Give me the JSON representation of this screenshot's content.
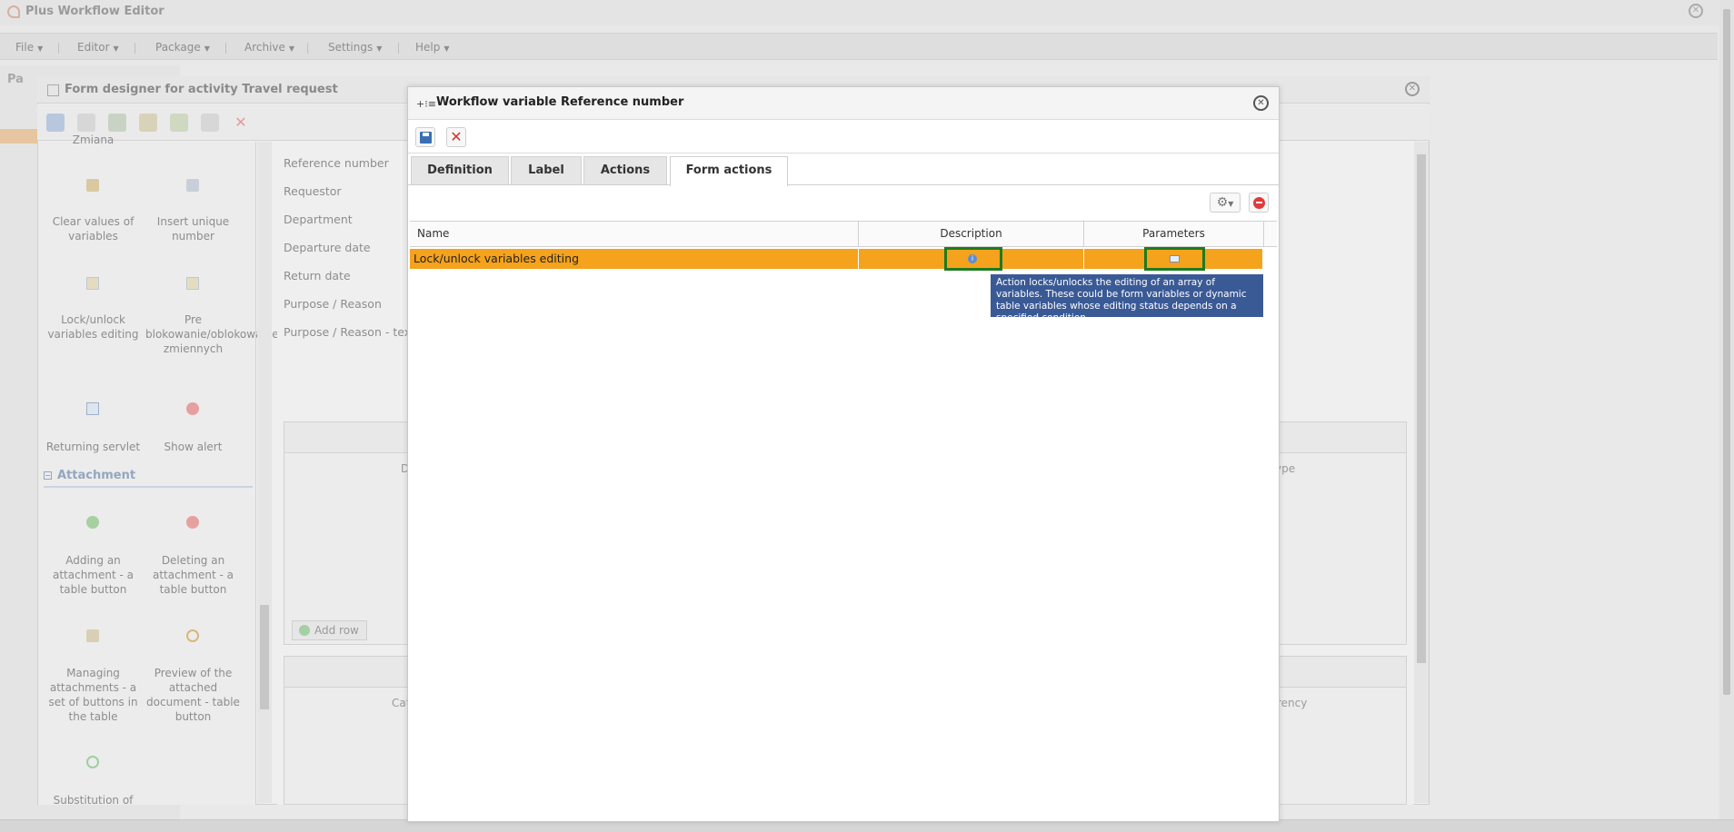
{
  "app": {
    "title": "Plus Workflow Editor",
    "menu": [
      "File",
      "Editor",
      "Package",
      "Archive",
      "Settings",
      "Help"
    ],
    "tree_label": "Pa"
  },
  "form_designer": {
    "title": "Form designer for activity Travel request",
    "palette": {
      "cut_top": "Zmiana",
      "items": [
        {
          "label": "Clear values of variables",
          "icon": "brush-icon"
        },
        {
          "label": "Insert unique number",
          "icon": "tag-icon"
        },
        {
          "label": "Lock/unlock variables editing",
          "icon": "lock-form-icon"
        },
        {
          "label": "Pre blokowanie/oblokowanie zmiennych",
          "icon": "lock-form-icon"
        },
        {
          "label": "Returning servlet",
          "icon": "servlet-icon"
        },
        {
          "label": "Show alert",
          "icon": "alert-icon"
        }
      ],
      "attachment_header": "Attachment",
      "attachment_items": [
        {
          "label": "Adding an attachment - a table button",
          "icon": "add-icon"
        },
        {
          "label": "Deleting an attachment - a table button",
          "icon": "delete-icon"
        },
        {
          "label": "Managing attachments - a set of buttons in the table",
          "icon": "attachments-icon"
        },
        {
          "label": "Preview of the attached document - table button",
          "icon": "magnifier-icon"
        },
        {
          "label": "Substitution of",
          "icon": "refresh-icon"
        }
      ]
    },
    "form_labels": [
      "Reference number",
      "Requestor",
      "Department",
      "Departure date",
      "Return date",
      "Purpose / Reason",
      "Purpose / Reason - text"
    ],
    "grid1": {
      "col_a": "D",
      "col_b": "ype",
      "add_row": "Add row"
    },
    "grid2": {
      "col_a": "Cat",
      "col_b": "rency"
    }
  },
  "dialog": {
    "title": "Workflow variable Reference number",
    "tabs": [
      "Definition",
      "Label",
      "Actions",
      "Form actions"
    ],
    "active_tab": "Form actions",
    "grid": {
      "columns": [
        "Name",
        "Description",
        "Parameters"
      ],
      "rows": [
        {
          "name": "Lock/unlock variables editing",
          "description_icon": "info-icon",
          "parameters_icon": "parameters-icon"
        }
      ]
    },
    "tooltip": "Action locks/unlocks the editing of an array of variables. These could be form variables or dynamic table variables whose editing status depends on a specified condition."
  },
  "colors": {
    "selected_row": "#f5a21c",
    "highlight_box": "#1e7a1e",
    "tooltip_bg": "#3a5a96"
  }
}
